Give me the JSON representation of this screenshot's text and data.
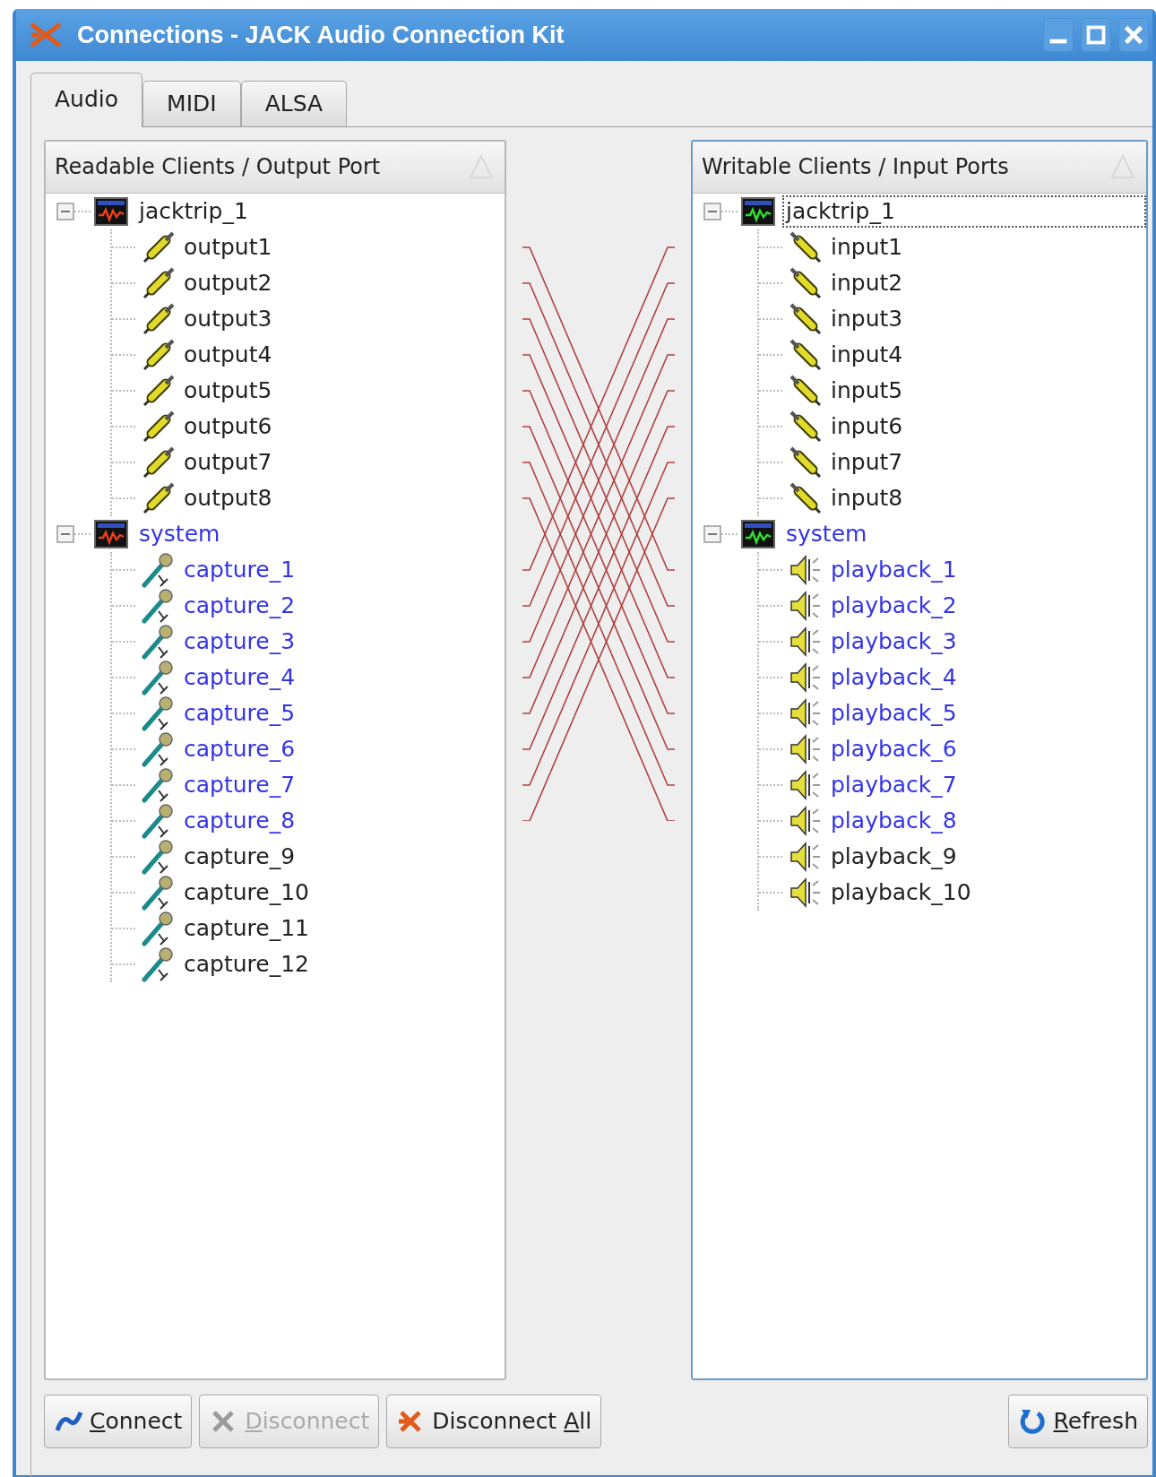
{
  "window": {
    "title": "Connections - JACK Audio Connection Kit"
  },
  "tabs": [
    {
      "label": "Audio",
      "selected": true
    },
    {
      "label": "MIDI",
      "selected": false
    },
    {
      "label": "ALSA",
      "selected": false
    }
  ],
  "readable": {
    "header": "Readable Clients / Output Port",
    "clients": [
      {
        "name": "jacktrip_1",
        "expanded": true,
        "highlighted": false,
        "selected": false,
        "ports": [
          {
            "name": "output1",
            "kind": "plug",
            "highlighted": false
          },
          {
            "name": "output2",
            "kind": "plug",
            "highlighted": false
          },
          {
            "name": "output3",
            "kind": "plug",
            "highlighted": false
          },
          {
            "name": "output4",
            "kind": "plug",
            "highlighted": false
          },
          {
            "name": "output5",
            "kind": "plug",
            "highlighted": false
          },
          {
            "name": "output6",
            "kind": "plug",
            "highlighted": false
          },
          {
            "name": "output7",
            "kind": "plug",
            "highlighted": false
          },
          {
            "name": "output8",
            "kind": "plug",
            "highlighted": false
          }
        ]
      },
      {
        "name": "system",
        "expanded": true,
        "highlighted": true,
        "selected": false,
        "ports": [
          {
            "name": "capture_1",
            "kind": "mic",
            "highlighted": true
          },
          {
            "name": "capture_2",
            "kind": "mic",
            "highlighted": true
          },
          {
            "name": "capture_3",
            "kind": "mic",
            "highlighted": true
          },
          {
            "name": "capture_4",
            "kind": "mic",
            "highlighted": true
          },
          {
            "name": "capture_5",
            "kind": "mic",
            "highlighted": true
          },
          {
            "name": "capture_6",
            "kind": "mic",
            "highlighted": true
          },
          {
            "name": "capture_7",
            "kind": "mic",
            "highlighted": true
          },
          {
            "name": "capture_8",
            "kind": "mic",
            "highlighted": true
          },
          {
            "name": "capture_9",
            "kind": "mic",
            "highlighted": false
          },
          {
            "name": "capture_10",
            "kind": "mic",
            "highlighted": false
          },
          {
            "name": "capture_11",
            "kind": "mic",
            "highlighted": false
          },
          {
            "name": "capture_12",
            "kind": "mic",
            "highlighted": false
          }
        ]
      }
    ]
  },
  "writable": {
    "header": "Writable Clients / Input Ports",
    "clients": [
      {
        "name": "jacktrip_1",
        "expanded": true,
        "highlighted": false,
        "selected": true,
        "ports": [
          {
            "name": "input1",
            "kind": "plug",
            "highlighted": false
          },
          {
            "name": "input2",
            "kind": "plug",
            "highlighted": false
          },
          {
            "name": "input3",
            "kind": "plug",
            "highlighted": false
          },
          {
            "name": "input4",
            "kind": "plug",
            "highlighted": false
          },
          {
            "name": "input5",
            "kind": "plug",
            "highlighted": false
          },
          {
            "name": "input6",
            "kind": "plug",
            "highlighted": false
          },
          {
            "name": "input7",
            "kind": "plug",
            "highlighted": false
          },
          {
            "name": "input8",
            "kind": "plug",
            "highlighted": false
          }
        ]
      },
      {
        "name": "system",
        "expanded": true,
        "highlighted": true,
        "selected": false,
        "ports": [
          {
            "name": "playback_1",
            "kind": "speaker",
            "highlighted": true
          },
          {
            "name": "playback_2",
            "kind": "speaker",
            "highlighted": true
          },
          {
            "name": "playback_3",
            "kind": "speaker",
            "highlighted": true
          },
          {
            "name": "playback_4",
            "kind": "speaker",
            "highlighted": true
          },
          {
            "name": "playback_5",
            "kind": "speaker",
            "highlighted": true
          },
          {
            "name": "playback_6",
            "kind": "speaker",
            "highlighted": true
          },
          {
            "name": "playback_7",
            "kind": "speaker",
            "highlighted": true
          },
          {
            "name": "playback_8",
            "kind": "speaker",
            "highlighted": true
          },
          {
            "name": "playback_9",
            "kind": "speaker",
            "highlighted": false
          },
          {
            "name": "playback_10",
            "kind": "speaker",
            "highlighted": false
          }
        ]
      }
    ]
  },
  "buttons_left": [
    {
      "kind": "connect",
      "key": "C",
      "after": "onnect",
      "disabled": false
    },
    {
      "kind": "disconnect",
      "key": "D",
      "after": "isconnect",
      "disabled": true
    },
    {
      "kind": "disconnect_all",
      "before": "Disconnect ",
      "key": "A",
      "after": "ll",
      "disabled": false
    }
  ],
  "buttons_right": [
    {
      "kind": "refresh",
      "key": "R",
      "after": "efresh",
      "disabled": false
    }
  ]
}
